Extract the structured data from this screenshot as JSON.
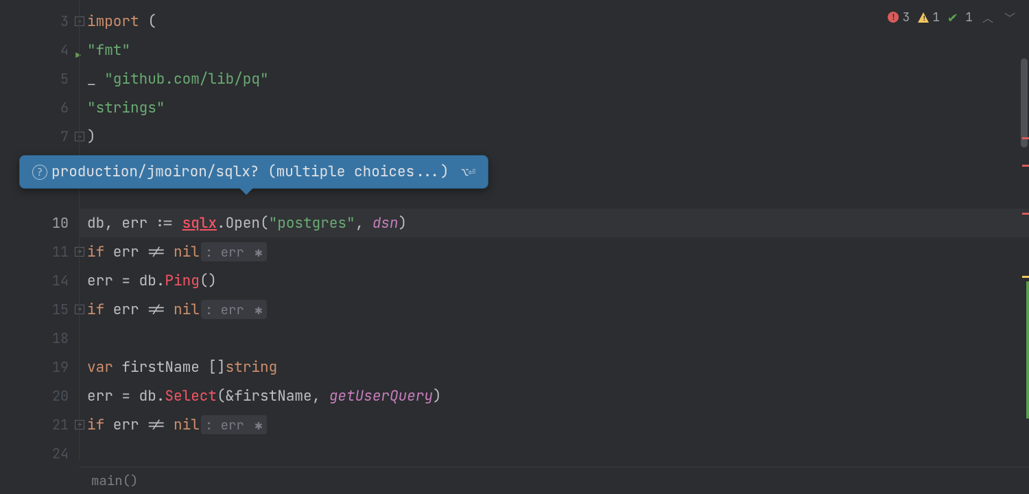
{
  "inspection": {
    "errors": "3",
    "warnings": "1",
    "ok": "1"
  },
  "tooltip": {
    "text": "production/jmoiron/sqlx? (multiple choices...)",
    "shortcut": "⌥⏎"
  },
  "breadcrumb": "main()",
  "lines": {
    "n3": "3",
    "n4": "4",
    "n5": "5",
    "n6": "6",
    "n7": "7",
    "n10": "10",
    "n11": "11",
    "n14": "14",
    "n15": "15",
    "n18": "18",
    "n19": "19",
    "n20": "20",
    "n21": "21",
    "n24": "24"
  },
  "code": {
    "import_kw": "import",
    "import_paren_open": " (",
    "fmt": "\"fmt\"",
    "blank": "_ ",
    "libpq": "\"github.com/lib/pq\"",
    "strings": "\"strings\"",
    "paren_close": ")",
    "l10_a": "db, err := ",
    "l10_sqlx": "sqlx",
    "l10_b": ".Open(",
    "l10_pg": "\"postgres\"",
    "l10_c": ", ",
    "l10_dsn": "dsn",
    "l10_d": ")",
    "if_kw": "if",
    "err_var": " err ",
    "neq": "!= ",
    "nil_kw": "nil",
    "hint_err": ": err",
    "l14_a": "err = db.",
    "l14_ping": "Ping",
    "l14_b": "()",
    "var_kw": "var",
    "l19_a": " firstName []",
    "string_type": "string",
    "l20_a": "err = db.",
    "l20_select": "Select",
    "l20_b": "(&firstName, ",
    "l20_q": "getUserQuery",
    "l20_c": ")"
  }
}
